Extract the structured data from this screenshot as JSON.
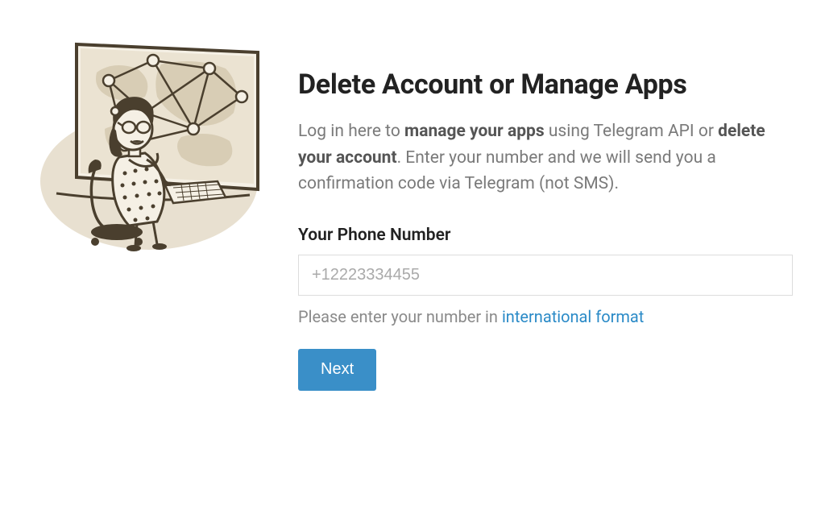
{
  "heading": "Delete Account or Manage Apps",
  "description": {
    "prefix": "Log in here to ",
    "bold1": "manage your apps",
    "middle": " using Telegram API or ",
    "bold2": "delete your account",
    "suffix": ". Enter your number and we will send you a confirmation code via Telegram (not SMS)."
  },
  "form": {
    "phone_label": "Your Phone Number",
    "phone_placeholder": "+12223334455",
    "hint_prefix": "Please enter your number in ",
    "hint_link": "international format",
    "next_button": "Next"
  }
}
